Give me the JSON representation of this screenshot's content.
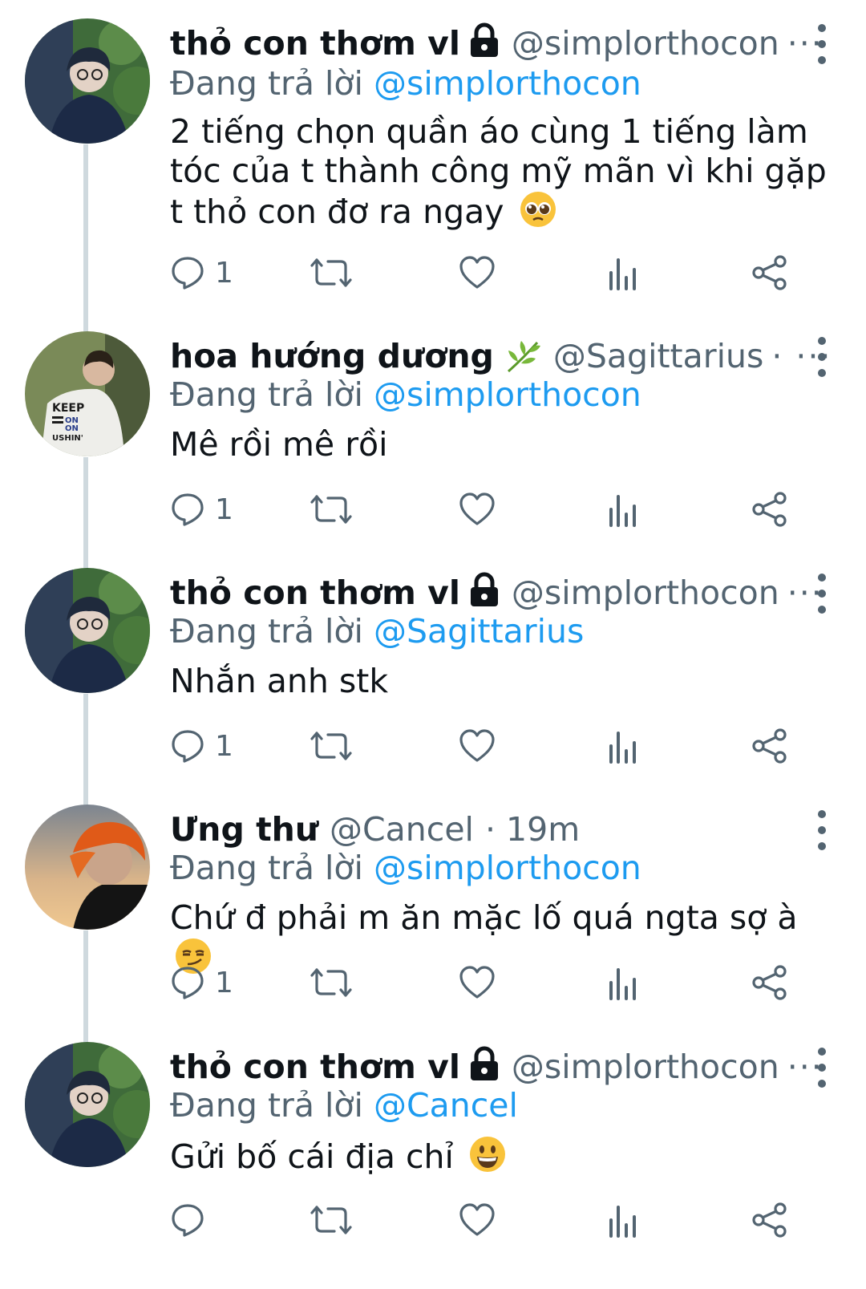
{
  "accent_color": "#1d9bf0",
  "muted_color": "#536471",
  "reply_prefix": "Đang trả lời",
  "tweets": [
    {
      "avatar": "avatar-boy-glasses",
      "name": "thỏ con thơm vl",
      "badge_icon": "lock-icon",
      "handle": "@simplorthocon",
      "meta": "···",
      "reply_to": "@simplorthocon",
      "text": "2 tiếng chọn quần áo cùng 1 tiếng làm tóc của t thành công mỹ mãn vì khi gặp t thỏ con đơ ra ngay",
      "emoji": "pleading-face-emoji",
      "reply_count": "1"
    },
    {
      "avatar": "avatar-white-shirt",
      "name": "hoa hướng dương",
      "badge_icon": "herb-icon",
      "handle": "@Sagittarius",
      "meta": "· ···",
      "reply_to": "@simplorthocon",
      "text": "Mê rồi mê rồi",
      "emoji": "",
      "reply_count": "1"
    },
    {
      "avatar": "avatar-boy-glasses",
      "name": "thỏ con thơm vl",
      "badge_icon": "lock-icon",
      "handle": "@simplorthocon",
      "meta": "···",
      "reply_to": "@Sagittarius",
      "text": "Nhắn anh stk",
      "emoji": "",
      "reply_count": "1"
    },
    {
      "avatar": "avatar-orange-hair",
      "name": "Ưng thư",
      "badge_icon": "",
      "handle": "@Cancel",
      "meta": "· 19m",
      "reply_to": "@simplorthocon",
      "text": "Chứ đ phải m ăn mặc lố quá ngta sợ à",
      "emoji": "smirking-face-emoji",
      "reply_count": "1"
    },
    {
      "avatar": "avatar-boy-glasses",
      "name": "thỏ con thơm vl",
      "badge_icon": "lock-icon",
      "handle": "@simplorthocon",
      "meta": "···",
      "reply_to": "@Cancel",
      "text": "Gửi bố cái địa chỉ",
      "emoji": "grinning-face-emoji",
      "reply_count": ""
    }
  ]
}
